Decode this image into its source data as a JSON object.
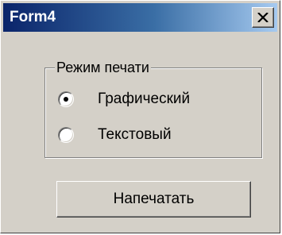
{
  "window": {
    "title": "Form4",
    "close_label": "X"
  },
  "group": {
    "label": "Режим печати",
    "options": [
      {
        "label": "Графический",
        "selected": true
      },
      {
        "label": "Текстовый",
        "selected": false
      }
    ]
  },
  "actions": {
    "print_label": "Напечатать"
  },
  "colors": {
    "title_start": "#0a246a",
    "title_end": "#a6caf0",
    "face": "#d4d0c8"
  }
}
